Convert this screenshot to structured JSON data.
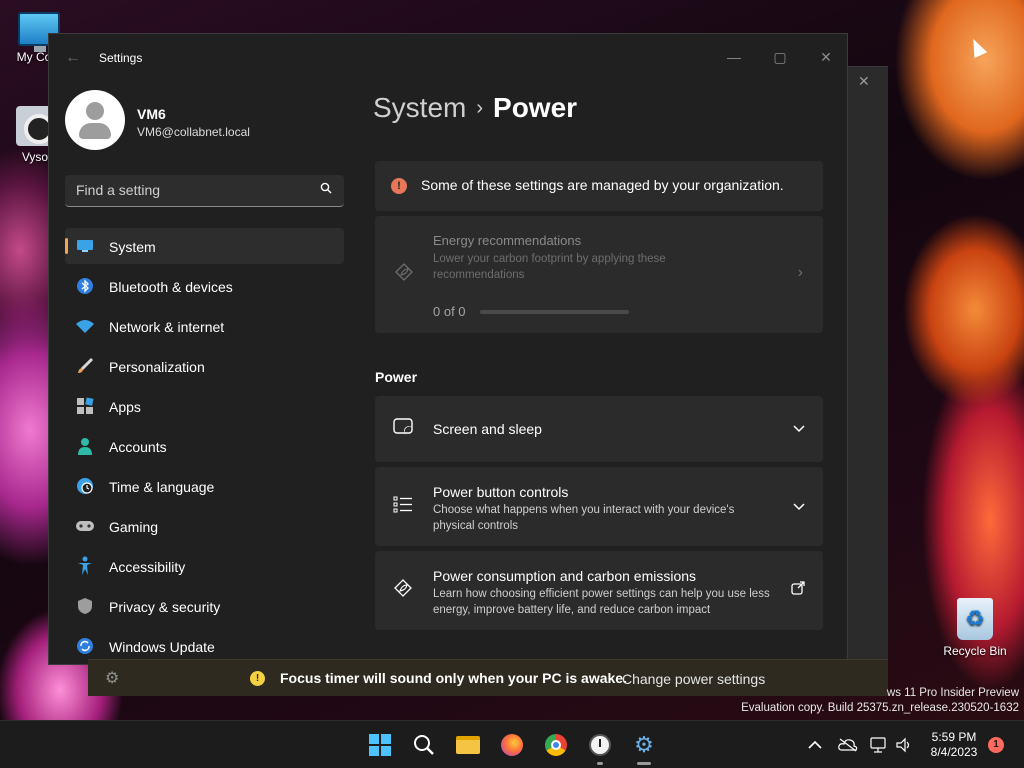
{
  "desktop": {
    "icons": [
      {
        "label": "My Com"
      },
      {
        "label": "Vyso"
      },
      {
        "label": "Recycle Bin"
      }
    ],
    "watermark": [
      "ws 11 Pro Insider Preview",
      "Evaluation copy. Build 25375.zn_release.230520-1632"
    ]
  },
  "window": {
    "title": "Settings",
    "controls": {
      "minimize": "—",
      "maximize": "▢",
      "close": "✕"
    },
    "back_icon": "arrow-left-icon"
  },
  "profile": {
    "name": "VM6",
    "email": "VM6@collabnet.local"
  },
  "search": {
    "placeholder": "Find a setting"
  },
  "nav": {
    "items": [
      {
        "label": "System",
        "icon": "monitor-icon",
        "active": true
      },
      {
        "label": "Bluetooth & devices",
        "icon": "bluetooth-icon"
      },
      {
        "label": "Network & internet",
        "icon": "wifi-icon"
      },
      {
        "label": "Personalization",
        "icon": "brush-icon"
      },
      {
        "label": "Apps",
        "icon": "apps-icon"
      },
      {
        "label": "Accounts",
        "icon": "person-icon"
      },
      {
        "label": "Time & language",
        "icon": "globe-clock-icon"
      },
      {
        "label": "Gaming",
        "icon": "gamepad-icon"
      },
      {
        "label": "Accessibility",
        "icon": "accessibility-icon"
      },
      {
        "label": "Privacy & security",
        "icon": "shield-icon"
      },
      {
        "label": "Windows Update",
        "icon": "update-icon"
      }
    ]
  },
  "breadcrumb": {
    "parent": "System",
    "separator": "›",
    "current": "Power"
  },
  "notice": {
    "text": "Some of these settings are managed by your organization."
  },
  "energy": {
    "title": "Energy recommendations",
    "subtitle": "Lower your carbon footprint by applying these recommendations",
    "count": "0 of 0",
    "progress_fraction": 0
  },
  "power_section": {
    "heading": "Power",
    "rows": [
      {
        "title": "Screen and sleep",
        "subtitle": "",
        "icon": "screen-sleep-icon",
        "action": "chevron-down-icon"
      },
      {
        "title": "Power button controls",
        "subtitle": "Choose what happens when you interact with your device's physical controls",
        "icon": "list-icon",
        "action": "chevron-down-icon"
      },
      {
        "title": "Power consumption and carbon emissions",
        "subtitle": "Learn how choosing efficient power settings can help you use less energy, improve battery life, and reduce carbon impact",
        "icon": "leaf-icon",
        "action": "external-link-icon"
      }
    ]
  },
  "focus_bar": {
    "message": "Focus timer will sound only when your PC is awake.",
    "link": "Change power settings"
  },
  "taskbar": {
    "time": "5:59 PM",
    "date": "8/4/2023",
    "notification_count": "1"
  },
  "colors": {
    "accent": "#f2a35a",
    "window_bg": "#202020",
    "card_bg": "#2b2b2b",
    "notice_icon": "#e8775a",
    "focus_warn": "#f5d142"
  }
}
